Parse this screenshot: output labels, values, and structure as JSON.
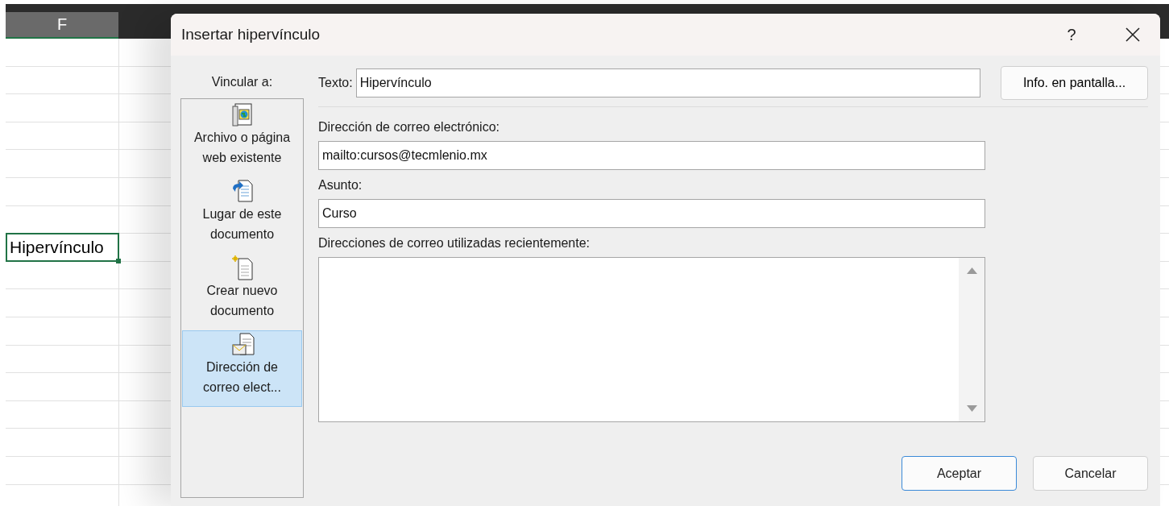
{
  "spreadsheet": {
    "column_header": "F",
    "selected_cell": {
      "value": "Hipervínculo"
    }
  },
  "dialog": {
    "title": "Insertar hipervínculo",
    "help": "?",
    "link_to": {
      "label": "Vincular a:",
      "items": [
        {
          "label": "Archivo o página web existente",
          "selected": false
        },
        {
          "label": "Lugar de este documento",
          "selected": false
        },
        {
          "label": "Crear nuevo documento",
          "selected": false
        },
        {
          "label": "Dirección de correo elect...",
          "selected": true
        }
      ]
    },
    "text": {
      "label": "Texto:",
      "value": "Hipervínculo"
    },
    "screen_tip_button": "Info. en pantalla...",
    "email": {
      "label": "Dirección de correo electrónico:",
      "value": "mailto:cursos@tecmlenio.mx"
    },
    "subject": {
      "label": "Asunto:",
      "value": "Curso"
    },
    "recent": {
      "label": "Direcciones de correo utilizadas recientemente:"
    },
    "buttons": [
      {
        "label": "Aceptar",
        "default": true
      },
      {
        "label": "Cancelar",
        "default": false
      }
    ]
  }
}
